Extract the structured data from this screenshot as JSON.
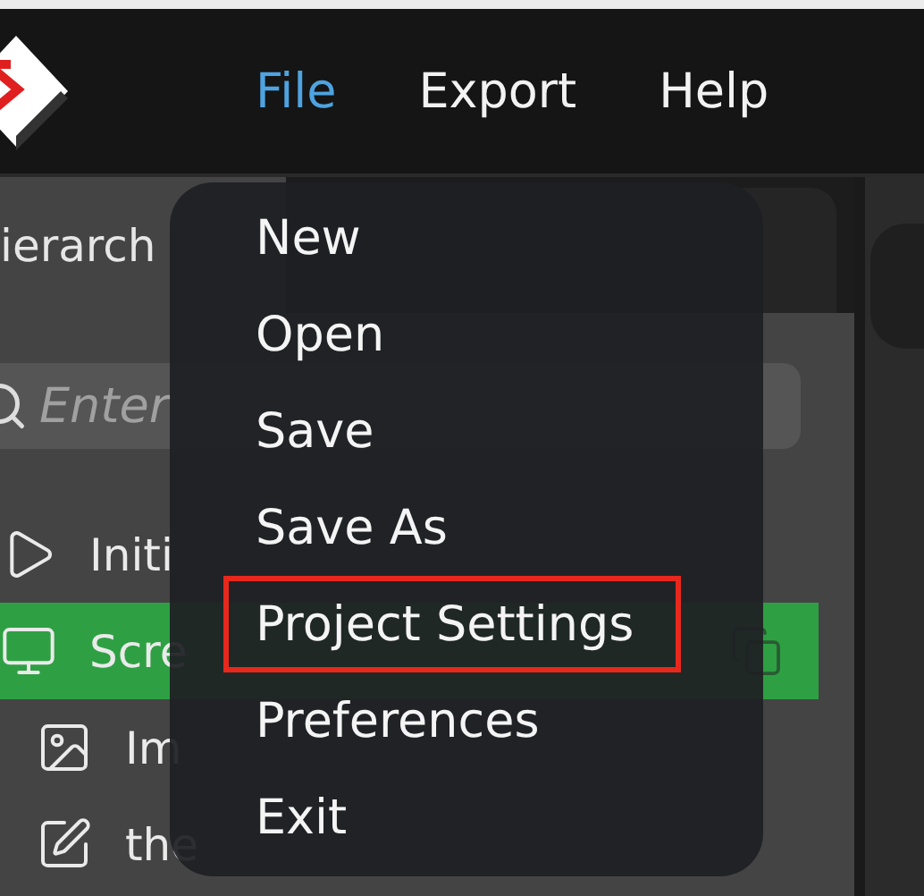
{
  "menubar": {
    "items": [
      {
        "label": "File",
        "selected": true
      },
      {
        "label": "Export",
        "selected": false
      },
      {
        "label": "Help",
        "selected": false
      }
    ]
  },
  "panel": {
    "tabs": [
      {
        "label": "ierarch",
        "selected": true
      }
    ],
    "search": {
      "placeholder": "Enter"
    },
    "tree": [
      {
        "label": "Initi",
        "kind": "actions",
        "selected": false
      },
      {
        "label": "Scre",
        "kind": "screen",
        "selected": true,
        "children": [
          {
            "label": "Im",
            "kind": "image",
            "selected": false
          },
          {
            "label": "the",
            "kind": "text",
            "selected": false
          }
        ]
      }
    ]
  },
  "file_menu": {
    "items": [
      {
        "label": "New",
        "highlighted": false
      },
      {
        "label": "Open",
        "highlighted": false
      },
      {
        "label": "Save",
        "highlighted": false
      },
      {
        "label": "Save As",
        "highlighted": false
      },
      {
        "label": "Project Settings",
        "highlighted": true
      },
      {
        "label": "Preferences",
        "highlighted": false
      },
      {
        "label": "Exit",
        "highlighted": false
      }
    ]
  }
}
